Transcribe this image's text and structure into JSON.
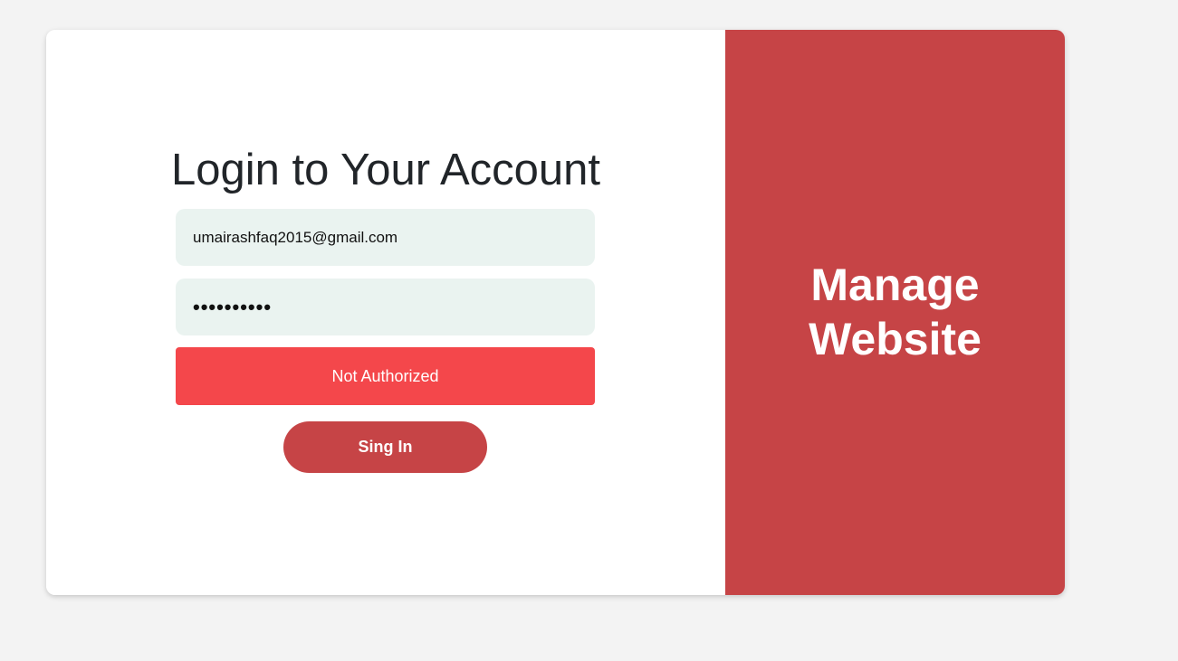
{
  "login": {
    "title": "Login to Your Account",
    "email_value": "umairashfaq2015@gmail.com",
    "password_masked": "••••••••••",
    "error_message": "Not Authorized",
    "signin_label": "Sing In"
  },
  "side_panel": {
    "title_line1": "Manage",
    "title_line2": "Website"
  },
  "colors": {
    "accent": "#c64446",
    "error": "#f4474b",
    "input_bg": "#eaf3f0",
    "page_bg": "#f3f3f3"
  }
}
